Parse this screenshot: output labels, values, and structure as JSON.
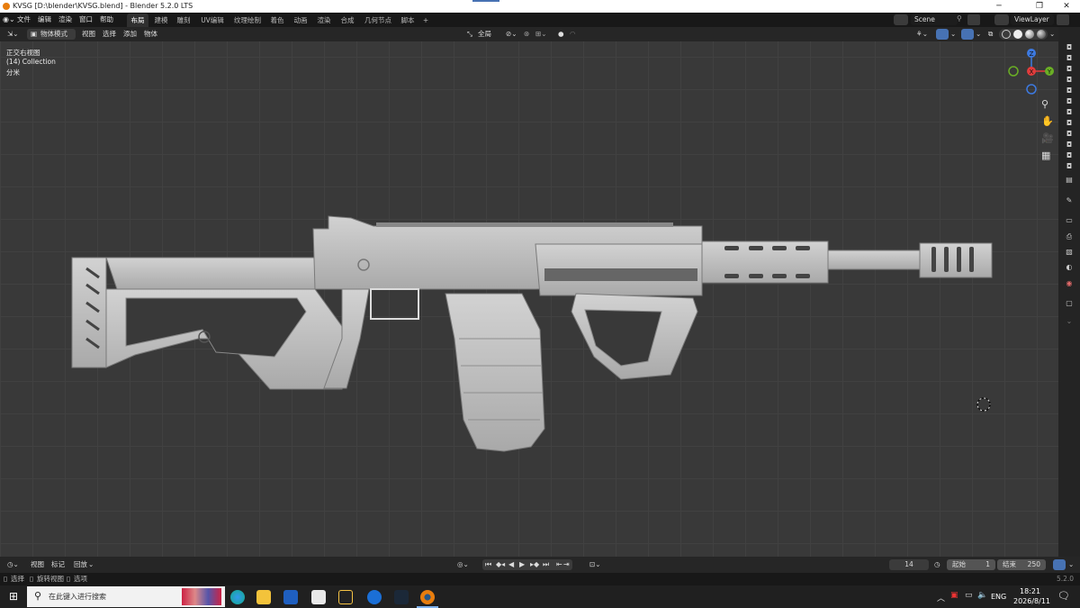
{
  "window": {
    "title": "KVSG [D:\\blender\\KVSG.blend] - Blender 5.2.0 LTS",
    "minimize": "─",
    "maximize": "❐",
    "close": "✕"
  },
  "menus": [
    "文件",
    "编辑",
    "渲染",
    "窗口",
    "帮助"
  ],
  "workspaces": [
    "布局",
    "建模",
    "雕刻",
    "UV编辑",
    "纹理绘制",
    "着色",
    "动画",
    "渲染",
    "合成",
    "几何节点",
    "脚本",
    "+"
  ],
  "active_workspace_index": 0,
  "scene": {
    "name": "Scene",
    "view_layer": "ViewLayer"
  },
  "header": {
    "mode": "物体模式",
    "view": "视图",
    "select": "选择",
    "add": "添加",
    "object": "物体",
    "transform": "全局"
  },
  "viewport": {
    "view_name": "正交右视图",
    "collection": "(14) Collection",
    "unit": "分米"
  },
  "gizmo": {
    "x": "X",
    "y": "Y",
    "z": "Z"
  },
  "timeline": {
    "menu": [
      "视图",
      "标记",
      "回放"
    ],
    "current_frame": "14",
    "start_label": "起始",
    "start": "1",
    "end_label": "结束",
    "end": "250"
  },
  "status": {
    "select": "选择",
    "rotate": "旋转视图",
    "options": "选项",
    "version": "5.2.0"
  },
  "taskbar": {
    "search_placeholder": "在此键入进行搜索",
    "lang": "ENG",
    "time": "18:21",
    "date": "2026/8/11"
  },
  "colors": {
    "accent": "#4772b3",
    "gizmo_x": "#e23c3c",
    "gizmo_y": "#6aae25",
    "gizmo_z": "#3d7ae1",
    "model": "#c7c7c7"
  }
}
